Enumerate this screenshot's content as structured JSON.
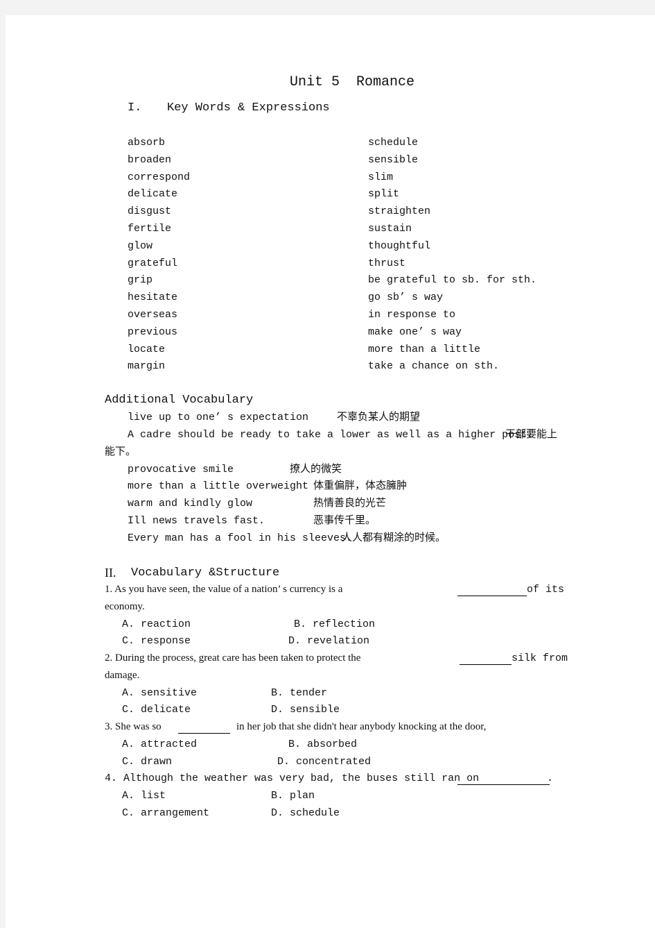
{
  "title": "Unit 5  Romance",
  "section1": {
    "numeral": "I.",
    "heading": "Key Words & Expressions",
    "left_words": [
      "absorb",
      "broaden",
      "correspond",
      "delicate",
      "disgust",
      "fertile",
      "glow",
      "grateful",
      "grip",
      "hesitate",
      "overseas",
      "previous",
      "locate",
      "margin"
    ],
    "right_words": [
      "schedule",
      "sensible",
      "slim",
      "split",
      "straighten",
      "sustain",
      "thoughtful",
      "thrust",
      "be grateful to sb. for sth.",
      "go sb’ s way",
      "in response to",
      "make one’ s way",
      "more than a little",
      "take a chance on sth."
    ]
  },
  "additional": {
    "heading": "Additional Vocabulary",
    "items": [
      {
        "en": "live up to one’ s expectation",
        "cn": "不辜负某人的期望"
      },
      {
        "en": "A cadre should be ready to take a lower as well as a higher post.",
        "cn": "干部要能上",
        "cn_cont": "能下。"
      },
      {
        "en": "provocative smile",
        "cn": "撩人的微笑"
      },
      {
        "en": "more than a little overweight",
        "cn": "体重偏胖，体态臃肿"
      },
      {
        "en": "warm and kindly glow",
        "cn": "热情善良的光芒"
      },
      {
        "en": "Ill news travels fast.",
        "cn": "恶事传千里。"
      },
      {
        "en": "Every man has a fool in his sleeves.",
        "cn": "人人都有糊涂的时候。"
      }
    ]
  },
  "section2": {
    "numeral": "II.",
    "heading": "Vocabulary &Structure",
    "questions": [
      {
        "before": "1. As you have seen, the value of a nation’ s currency is a",
        "after": "of its",
        "cont": "economy.",
        "options": [
          "A. reaction",
          "B. reflection",
          "C. response",
          "D. revelation"
        ]
      },
      {
        "before": "2. During the process, great care has been taken to protect the",
        "after": "silk from",
        "cont": "damage.",
        "options": [
          "A. sensitive",
          "B. tender",
          "C. delicate",
          "D. sensible"
        ]
      },
      {
        "before": "3. She was so",
        "after": "in her job that she didn't hear anybody knocking at the door,",
        "cont": "",
        "options": [
          "A. attracted",
          "B. absorbed",
          "C. drawn",
          "D. concentrated"
        ]
      },
      {
        "before": "4. Although the weather was very bad, the buses still ran on",
        "after": ".",
        "cont": "",
        "options": [
          "A. list",
          "B. plan",
          "C. arrangement",
          "D. schedule"
        ]
      }
    ]
  }
}
